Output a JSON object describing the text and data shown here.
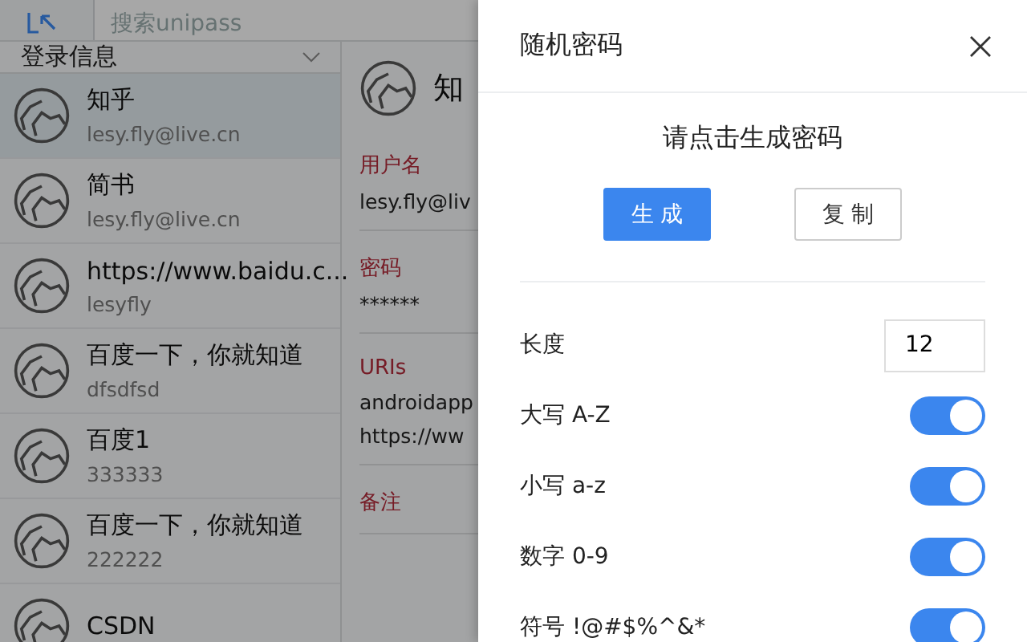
{
  "search": {
    "placeholder": "搜索unipass"
  },
  "sidebar": {
    "header": "登录信息",
    "items": [
      {
        "title": "知乎",
        "subtitle": "lesy.fly@live.cn",
        "selected": true
      },
      {
        "title": "简书",
        "subtitle": "lesy.fly@live.cn",
        "selected": false
      },
      {
        "title": "https://www.baidu.c...",
        "subtitle": "lesyfly",
        "selected": false
      },
      {
        "title": "百度一下，你就知道",
        "subtitle": "dfsdfsd",
        "selected": false
      },
      {
        "title": "百度1",
        "subtitle": "333333",
        "selected": false
      },
      {
        "title": "百度一下，你就知道",
        "subtitle": "222222",
        "selected": false
      },
      {
        "title": "CSDN",
        "selected": false
      }
    ]
  },
  "detail": {
    "title": "知",
    "fields": [
      {
        "label": "用户名",
        "values": [
          "lesy.fly@liv"
        ]
      },
      {
        "label": "密码",
        "values": [
          "******"
        ]
      },
      {
        "label": "URIs",
        "values": [
          "androidapp",
          "https://ww"
        ]
      },
      {
        "label": "备注"
      }
    ]
  },
  "modal": {
    "title": "随机密码",
    "prompt": "请点击生成密码",
    "buttons": [
      {
        "label": "生 成",
        "kind": "primary"
      },
      {
        "label": "复 制",
        "kind": "default"
      }
    ],
    "length": {
      "label": "长度",
      "value": "12"
    },
    "options": [
      {
        "label": "大写 A-Z",
        "on": true
      },
      {
        "label": "小写 a-z",
        "on": true
      },
      {
        "label": "数字 0-9",
        "on": true
      },
      {
        "label": "符号 !@#$%^&*",
        "on": true
      }
    ]
  }
}
